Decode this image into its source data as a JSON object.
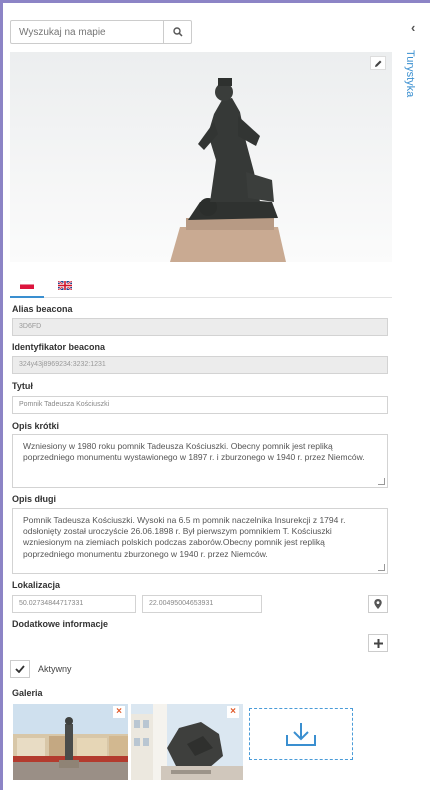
{
  "search": {
    "placeholder": "Wyszukaj na mapie"
  },
  "side_tab": {
    "label": "Turystyka"
  },
  "form": {
    "alias_label": "Alias beacona",
    "alias_value": "3D6FD",
    "id_label": "Identyfikator beacona",
    "id_value": "324y43j8969234:3232:1231",
    "title_label": "Tytuł",
    "title_value": "Pomnik Tadeusza Kościuszki",
    "short_label": "Opis krótki",
    "short_value": "Wzniesiony w 1980 roku pomnik Tadeusza Kościuszki. Obecny pomnik jest repliką poprzedniego monumentu wystawionego w 1897 r. i zburzonego w 1940 r. przez Niemców.",
    "long_label": "Opis długi",
    "long_value": "Pomnik Tadeusza Kościuszki. Wysoki na 6.5 m pomnik naczelnika Insurekcji z 1794 r. odsłonięty został uroczyście 26.06.1898 r. Był pierwszym pomnikiem T. Kościuszki wzniesionym na ziemiach polskich podczas zaborów.Obecny pomnik jest repliką poprzedniego monumentu zburzonego w 1940 r. przez Niemców.",
    "location_label": "Lokalizacja",
    "lat": "50.02734844717331",
    "lng": "22.00495004653931",
    "extra_label": "Dodatkowe informacje",
    "active_label": "Aktywny",
    "gallery_label": "Galeria"
  },
  "colors": {
    "accent": "#3a8fd0",
    "frame": "#8c84c6",
    "remove": "#e05a2a"
  },
  "icons": [
    "search-icon",
    "pencil-icon",
    "flag-pl-icon",
    "flag-uk-icon",
    "map-marker-icon",
    "plus-icon",
    "checkmark-icon",
    "close-icon",
    "download-icon",
    "chevron-left-icon"
  ]
}
